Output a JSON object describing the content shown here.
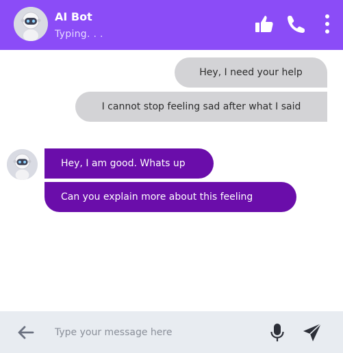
{
  "header": {
    "title": "AI Bot",
    "status": "Typing. . .",
    "accent_color": "#8b4cf7",
    "icons": [
      "robot-avatar-icon",
      "thumbs-up-icon",
      "phone-icon",
      "more-vertical-icon"
    ]
  },
  "messages": [
    {
      "from": "user",
      "text": "Hey, I need your help"
    },
    {
      "from": "user",
      "text": "I cannot stop feeling sad after what I said"
    },
    {
      "from": "bot",
      "text": "Hey, I am good. Whats up"
    },
    {
      "from": "bot",
      "text": "Can you explain more about this feeling"
    }
  ],
  "colors": {
    "sent_bubble": "#d3d3d6",
    "received_bubble": "#6a0daa",
    "composer_bg": "#e8ecf1"
  },
  "composer": {
    "placeholder": "Type your message here",
    "value": "",
    "icons": [
      "arrow-left-icon",
      "microphone-icon",
      "send-icon"
    ]
  }
}
